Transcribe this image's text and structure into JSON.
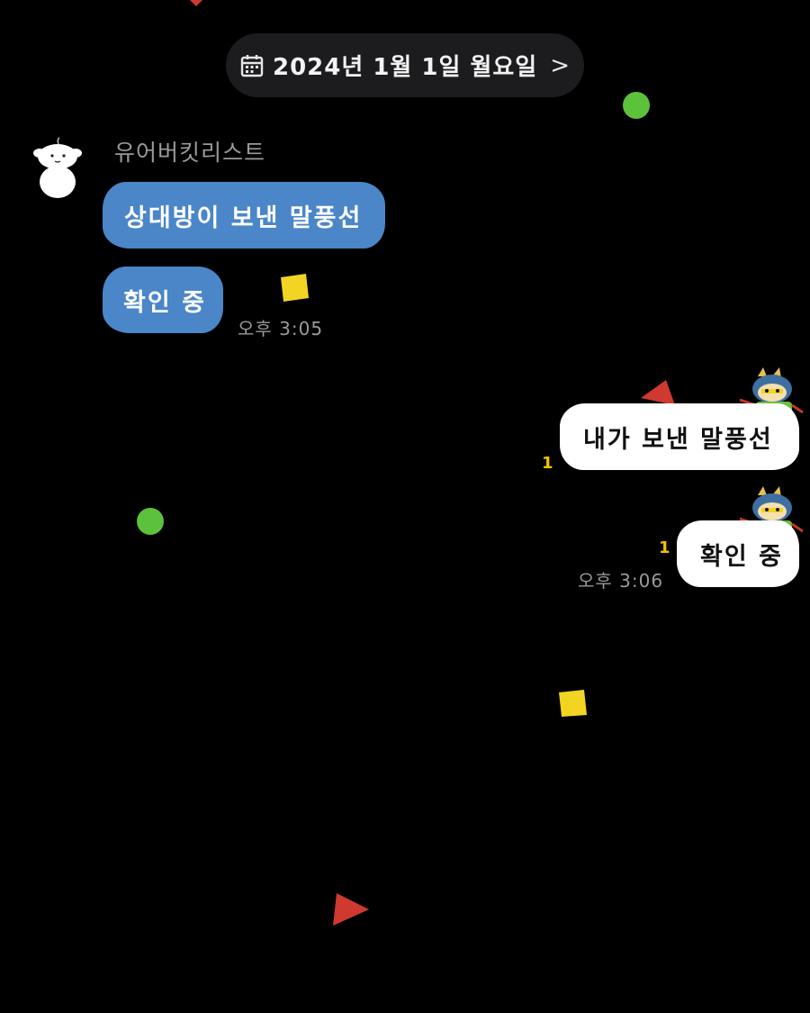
{
  "date_header": {
    "text": "2024년 1월 1일 월요일",
    "icon": "calendar-icon",
    "chevron": ">"
  },
  "received": {
    "sender_name": "유어버킷리스트",
    "avatar_icon": "white-puppy-avatar",
    "messages": [
      {
        "text": "상대방이 보낸 말풍선"
      },
      {
        "text": "확인 중"
      }
    ],
    "time": "오후 3:05"
  },
  "sent": {
    "sticker_icon": "cartoon-character-sticker",
    "messages": [
      {
        "text": "내가 보낸 말풍선",
        "unread": "1"
      },
      {
        "text": "확인 중",
        "unread": "1"
      }
    ],
    "time": "오후 3:06"
  },
  "colors": {
    "background": "#000000",
    "received_bubble": "#4a86c8",
    "sent_bubble": "#ffffff",
    "unread_count": "#f2c400",
    "date_pill": "#1c1c1e"
  }
}
